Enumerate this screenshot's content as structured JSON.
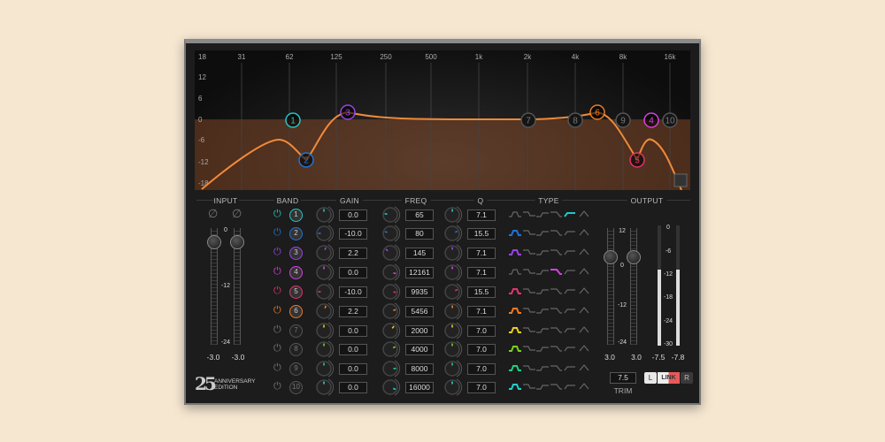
{
  "graph": {
    "freq_labels": [
      "31",
      "62",
      "125",
      "250",
      "500",
      "1k",
      "2k",
      "4k",
      "8k",
      "16k"
    ],
    "db_labels": [
      "18",
      "12",
      "6",
      "0",
      "-6",
      "-12",
      "-18"
    ]
  },
  "headers": {
    "input": "INPUT",
    "band": "BAND",
    "gain": "GAIN",
    "freq": "FREQ",
    "q": "Q",
    "type": "TYPE",
    "output": "OUTPUT"
  },
  "input": {
    "scale": [
      "0",
      "-12",
      "-24"
    ],
    "left": "-3.0",
    "right": "-3.0"
  },
  "bands": [
    {
      "num": "1",
      "on": true,
      "color": "#1fc8c8",
      "gain": "0.0",
      "freq": "65",
      "q": "7.1",
      "type": 4
    },
    {
      "num": "2",
      "on": true,
      "color": "#1e74d8",
      "gain": "-10.0",
      "freq": "80",
      "q": "15.5",
      "type": 0
    },
    {
      "num": "3",
      "on": true,
      "color": "#9a44e6",
      "gain": "2.2",
      "freq": "145",
      "q": "7.1",
      "type": 0
    },
    {
      "num": "4",
      "on": true,
      "color": "#d640e0",
      "gain": "0.0",
      "freq": "12161",
      "q": "7.1",
      "type": 3
    },
    {
      "num": "5",
      "on": true,
      "color": "#e23470",
      "gain": "-10.0",
      "freq": "9935",
      "q": "15.5",
      "type": 0
    },
    {
      "num": "6",
      "on": true,
      "color": "#f07a20",
      "gain": "2.2",
      "freq": "5456",
      "q": "7.1",
      "type": 0
    },
    {
      "num": "7",
      "on": false,
      "color": "#e8d020",
      "gain": "0.0",
      "freq": "2000",
      "q": "7.0",
      "type": 0
    },
    {
      "num": "8",
      "on": false,
      "color": "#7ad020",
      "gain": "0.0",
      "freq": "4000",
      "q": "7.0",
      "type": 0
    },
    {
      "num": "9",
      "on": false,
      "color": "#20d080",
      "gain": "0.0",
      "freq": "8000",
      "q": "7.0",
      "type": 0
    },
    {
      "num": "10",
      "on": false,
      "color": "#20d0d0",
      "gain": "0.0",
      "freq": "16000",
      "q": "7.0",
      "type": 0
    }
  ],
  "output": {
    "trim_scale": [
      "12",
      "0",
      "-12",
      "-24"
    ],
    "meter_scale": [
      "0",
      "-6",
      "-12",
      "-18",
      "-24",
      "-30"
    ],
    "trim_left": "3.0",
    "trim_right": "3.0",
    "meter_left": "-7.5",
    "meter_right": "-7.8",
    "meter_level_left": 0.63,
    "meter_level_right": 0.63,
    "trim": "7.5",
    "trim_label": "TRIM",
    "l": "L",
    "link": "LINK",
    "r": "R"
  },
  "logo": {
    "number": "25",
    "text": "ANNIVERSARY EDITION"
  }
}
